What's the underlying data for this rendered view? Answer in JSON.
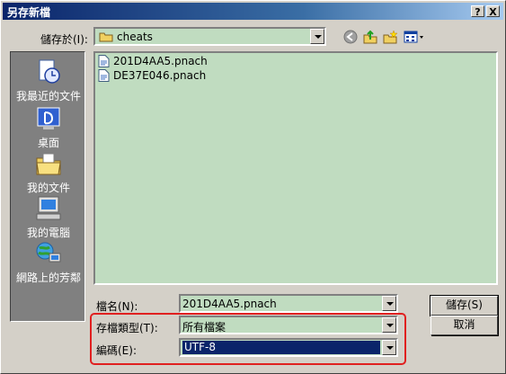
{
  "window": {
    "title": "另存新檔",
    "help_btn": "?",
    "close_btn": "X"
  },
  "save_in": {
    "label": "儲存於(I):",
    "value": "cheats"
  },
  "places": [
    {
      "label": "我最近的文件",
      "icon": "recent-documents-icon"
    },
    {
      "label": "桌面",
      "icon": "desktop-icon"
    },
    {
      "label": "我的文件",
      "icon": "my-documents-icon"
    },
    {
      "label": "我的電腦",
      "icon": "my-computer-icon"
    },
    {
      "label": "網路上的芳鄰",
      "icon": "network-places-icon"
    }
  ],
  "files": [
    {
      "name": "201D4AA5.pnach"
    },
    {
      "name": "DE37E046.pnach"
    }
  ],
  "filename": {
    "label": "檔名(N):",
    "value": "201D4AA5.pnach"
  },
  "filetype": {
    "label": "存檔類型(T):",
    "value": "所有檔案"
  },
  "encoding": {
    "label": "編碼(E):",
    "value": "UTF-8"
  },
  "buttons": {
    "save": "儲存(S)",
    "cancel": "取消"
  },
  "colors": {
    "list_bg": "#c0dcc0",
    "highlight": "#e02020",
    "selection": "#0a246a"
  }
}
